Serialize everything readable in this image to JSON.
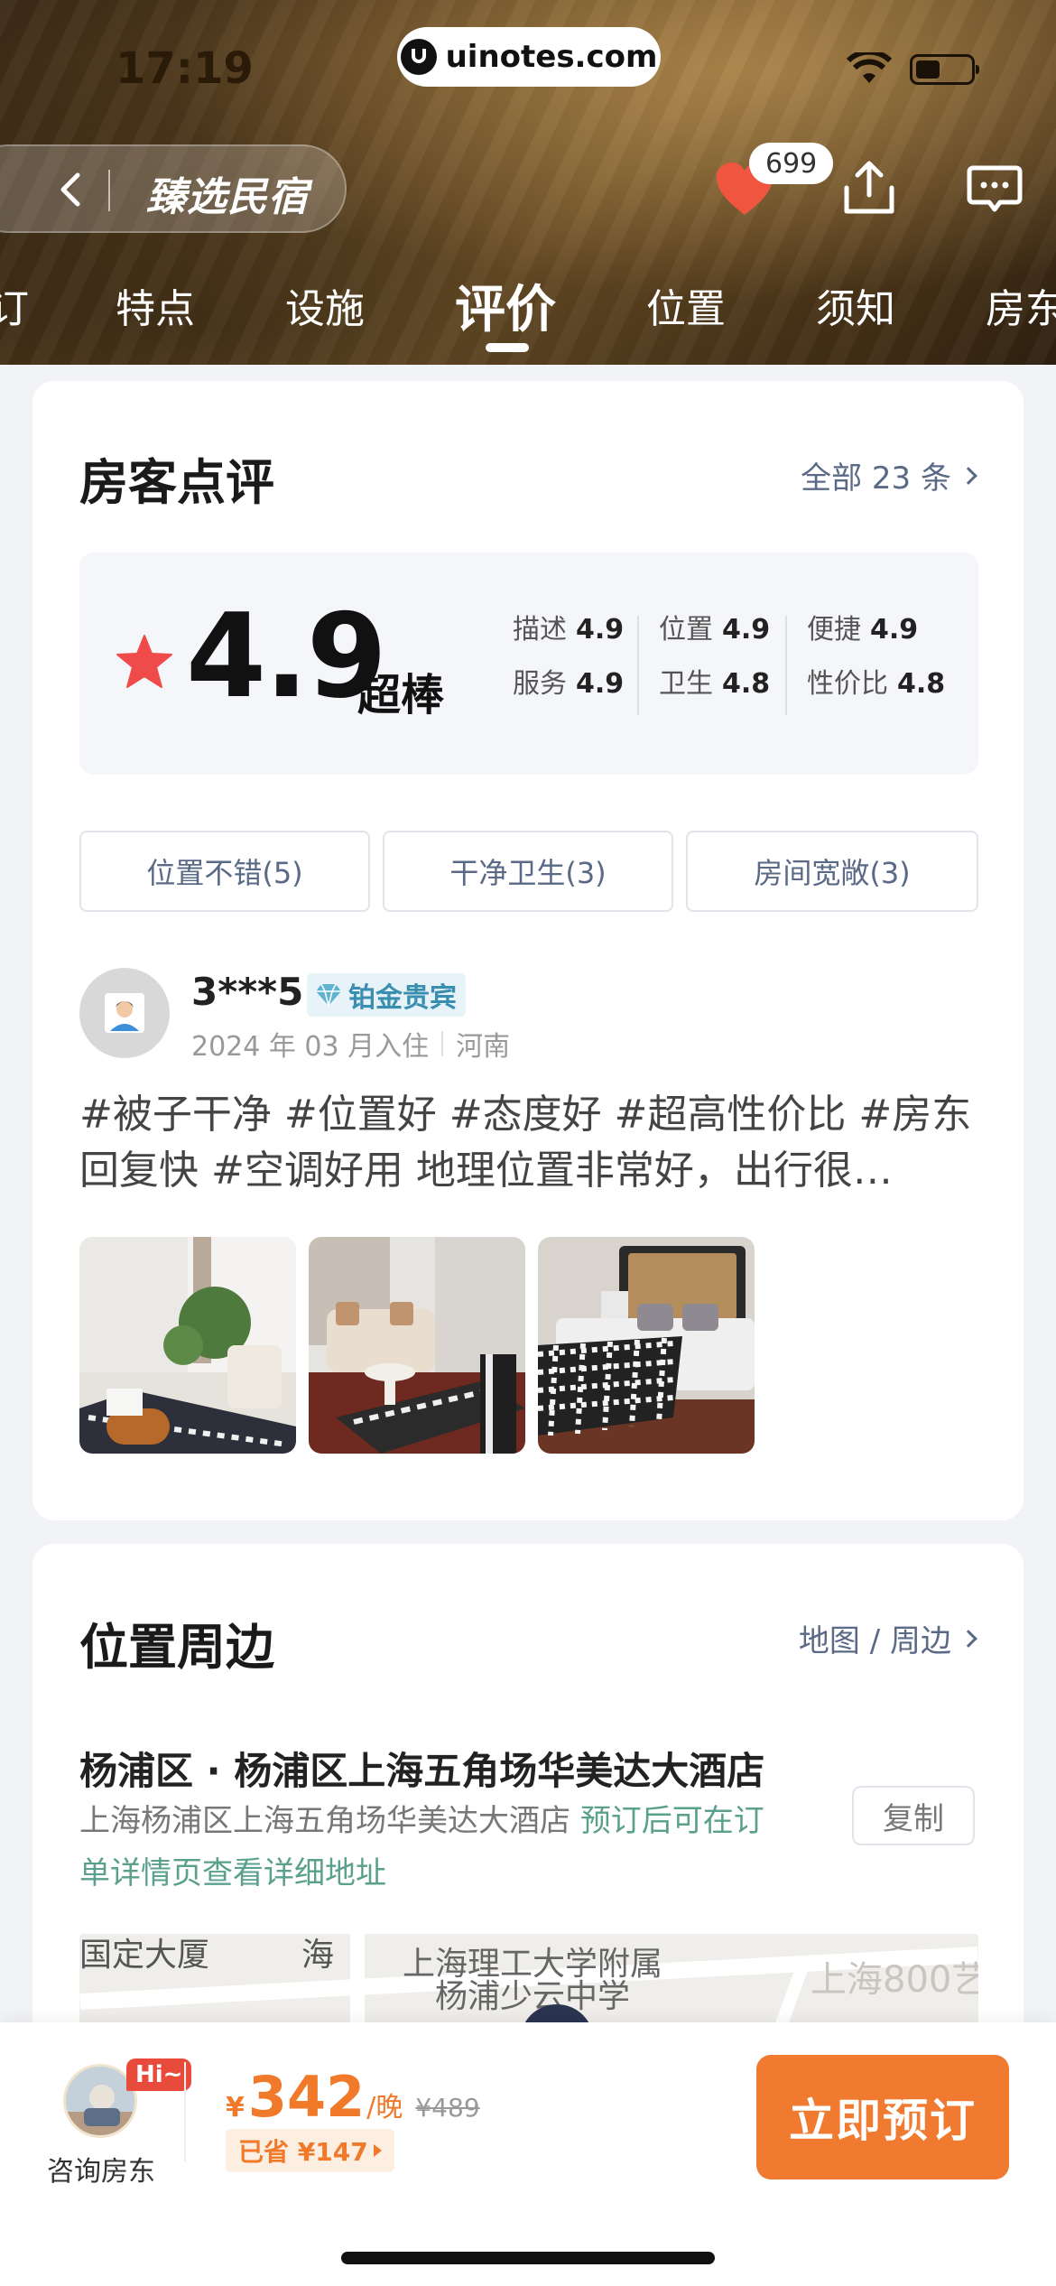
{
  "status_bar": {
    "time": "17:19",
    "watermark": "uinotes.com"
  },
  "nav": {
    "back_title": "臻选民宿",
    "favorite_count": "699",
    "tabs": [
      "订",
      "特点",
      "设施",
      "评价",
      "位置",
      "须知",
      "房东"
    ],
    "active_tab": "评价"
  },
  "reviews": {
    "title": "房客点评",
    "all_link": "全部 23 条",
    "score": "4.9",
    "score_word": "超棒",
    "sub_scores": [
      {
        "label": "描述",
        "value": "4.9"
      },
      {
        "label": "服务",
        "value": "4.9"
      },
      {
        "label": "位置",
        "value": "4.9"
      },
      {
        "label": "卫生",
        "value": "4.8"
      },
      {
        "label": "便捷",
        "value": "4.9"
      },
      {
        "label": "性价比",
        "value": "4.8"
      }
    ],
    "tags": [
      "位置不错(5)",
      "干净卫生(3)",
      "房间宽敞(3)"
    ],
    "item": {
      "name": "3***5",
      "badge": "铂金贵宾",
      "checkin": "2024 年 03 月入住",
      "region": "河南",
      "text": "#被子干净  #位置好  #态度好  #超高性价比  #房东回复快  #空调好用  地理位置非常好，出行很…"
    }
  },
  "location": {
    "title": "位置周边",
    "map_link": "地图 / 周边",
    "place": "杨浦区 · 杨浦区上海五角场华美达大酒店",
    "address": "上海杨浦区上海五角场华美达大酒店",
    "address_note": "预订后可在订单详情页查看详细地址",
    "copy_label": "复制",
    "map_labels": [
      "国定大厦",
      "海",
      "上海理工大学附属",
      "杨浦少云中学",
      "上海800艺"
    ]
  },
  "bottom_bar": {
    "hi": "Hi~",
    "host_label": "咨询房东",
    "currency": "¥",
    "price": "342",
    "per_night": "/晚",
    "original_price": "¥489",
    "saved": "已省 ¥147",
    "book_label": "立即预订"
  },
  "colors": {
    "accent": "#f07a2a",
    "star": "#ef4b4b",
    "link": "#5a6a86"
  }
}
